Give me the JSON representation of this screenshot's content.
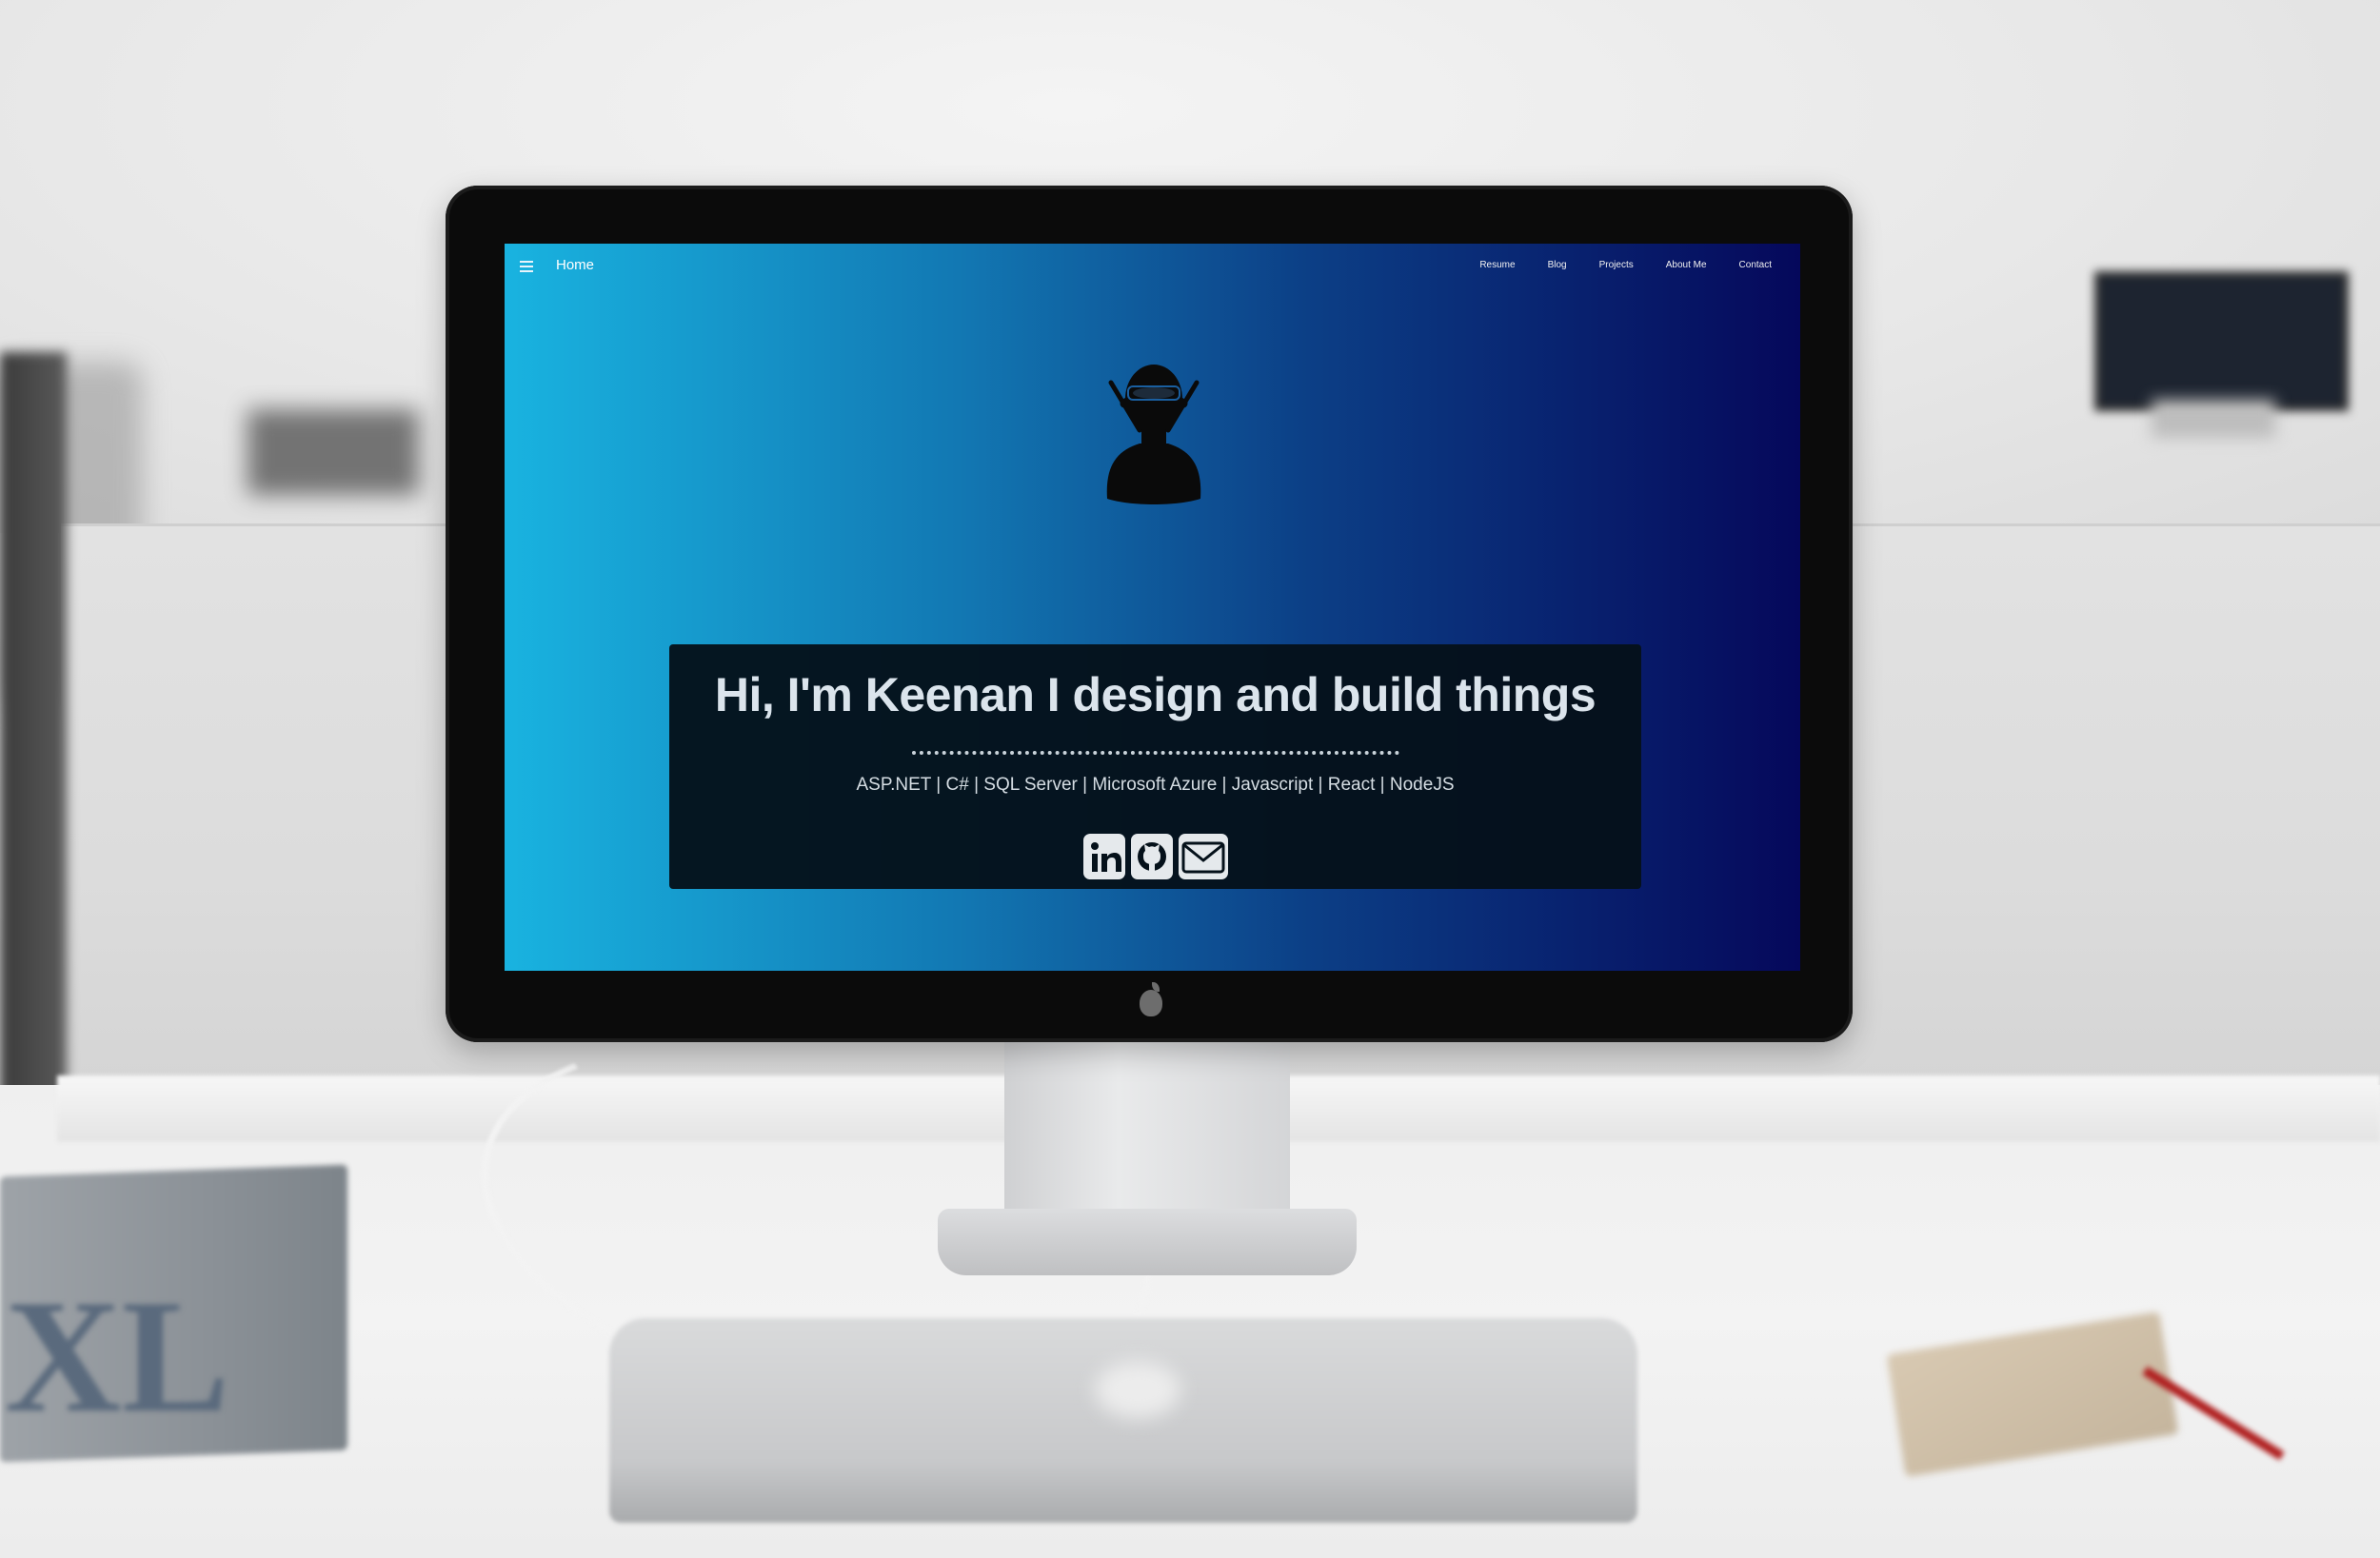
{
  "navbar": {
    "brand": "Home",
    "links": [
      "Resume",
      "Blog",
      "Projects",
      "About Me",
      "Contact"
    ]
  },
  "hero": {
    "title": "Hi, I'm Keenan I design and build things",
    "skills": "ASP.NET | C# | SQL Server | Microsoft Azure | Javascript | React | NodeJS"
  },
  "social": {
    "icons": [
      "linkedin-icon",
      "github-icon",
      "email-icon"
    ]
  },
  "background": {
    "book_spine_text": "XL"
  },
  "colors": {
    "gradient_start": "#19b3e0",
    "gradient_end": "#05085b",
    "card_bg": "#05111a",
    "text_light": "#dbe4ec"
  }
}
